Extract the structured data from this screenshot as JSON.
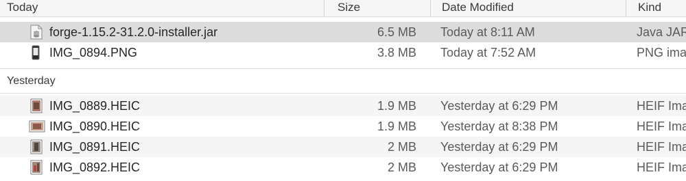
{
  "header": {
    "name_col": "Today",
    "size_col": "Size",
    "date_col": "Date Modified",
    "kind_col": "Kind"
  },
  "groups": [
    {
      "label": "Today",
      "files": [
        {
          "name": "forge-1.15.2-31.2.0-installer.jar",
          "size": "6.5 MB",
          "date": "Today at 8:11 AM",
          "kind": "Java JAR",
          "icon": "jar-file-icon"
        },
        {
          "name": "IMG_0894.PNG",
          "size": "3.8 MB",
          "date": "Today at 7:52 AM",
          "kind": "PNG image",
          "icon": "image-file-icon"
        }
      ]
    },
    {
      "label": "Yesterday",
      "files": [
        {
          "name": "IMG_0889.HEIC",
          "size": "1.9 MB",
          "date": "Yesterday at 6:29 PM",
          "kind": "HEIF Image",
          "icon": "image-file-icon"
        },
        {
          "name": "IMG_0890.HEIC",
          "size": "1.9 MB",
          "date": "Yesterday at 8:38 PM",
          "kind": "HEIF Image",
          "icon": "image-file-icon"
        },
        {
          "name": "IMG_0891.HEIC",
          "size": "2 MB",
          "date": "Yesterday at 6:29 PM",
          "kind": "HEIF Image",
          "icon": "image-file-icon"
        },
        {
          "name": "IMG_0892.HEIC",
          "size": "2 MB",
          "date": "Yesterday at 6:29 PM",
          "kind": "HEIF Image",
          "icon": "image-file-icon"
        }
      ]
    }
  ],
  "colors": {
    "selected_row": "#dcdcdc",
    "alt_row": "#f5f5f5",
    "header_bg": "#f6f6f6"
  }
}
